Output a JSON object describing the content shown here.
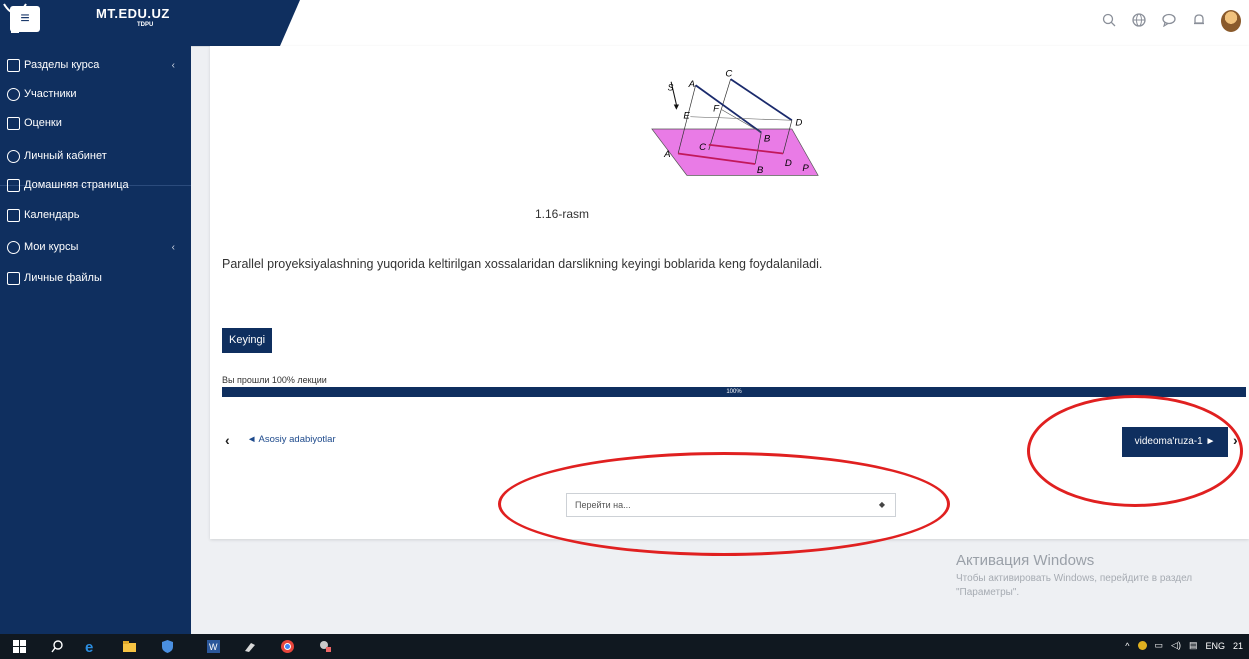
{
  "header": {
    "brand_title": "MT.EDU.UZ",
    "brand_sub": "TDPU",
    "icons": [
      "search-icon",
      "globe-icon",
      "chat-icon",
      "bell-icon",
      "avatar"
    ]
  },
  "sidebar": {
    "items": [
      {
        "label": "Разделы курса",
        "icon": "folder-icon",
        "chevron": "‹"
      },
      {
        "label": "Участники",
        "icon": "users-icon",
        "chevron": ""
      },
      {
        "label": "Оценки",
        "icon": "grades-icon",
        "chevron": ""
      },
      {
        "label": "Личный кабинет",
        "icon": "dashboard-icon",
        "chevron": ""
      },
      {
        "label": "Домашняя страница",
        "icon": "home-icon",
        "chevron": ""
      },
      {
        "label": "Календарь",
        "icon": "calendar-icon",
        "chevron": ""
      },
      {
        "label": "Мои курсы",
        "icon": "courses-icon",
        "chevron": "‹"
      },
      {
        "label": "Личные файлы",
        "icon": "files-icon",
        "chevron": ""
      }
    ]
  },
  "main": {
    "figure_labels": [
      "C",
      "A",
      "S",
      "E",
      "F",
      "D",
      "B",
      "A",
      "C",
      "B",
      "D",
      "P"
    ],
    "caption": "1.16-rasm",
    "paragraph": "Parallel proyeksiyalashning yuqorida keltirilgan xossalaridan darslikning keyingi boblarida keng foydalaniladi.",
    "next_button": "Keyingi",
    "progress_label": "Вы прошли 100% лекции",
    "progress_value": 100,
    "progress_text": "100%",
    "prev_link": "◄ Asosiy adabiyotlar",
    "next_activity": "videoma'ruza-1 ►",
    "jump_placeholder": "Перейти на..."
  },
  "windows": {
    "activation_title": "Активация Windows",
    "activation_text": "Чтобы активировать Windows, перейдите в раздел \"Параметры\".",
    "tray_lang": "ENG",
    "tray_time": "21"
  },
  "colors": {
    "primary": "#0f2f5f",
    "highlight": "#e02020",
    "plane": "#e97be6"
  }
}
